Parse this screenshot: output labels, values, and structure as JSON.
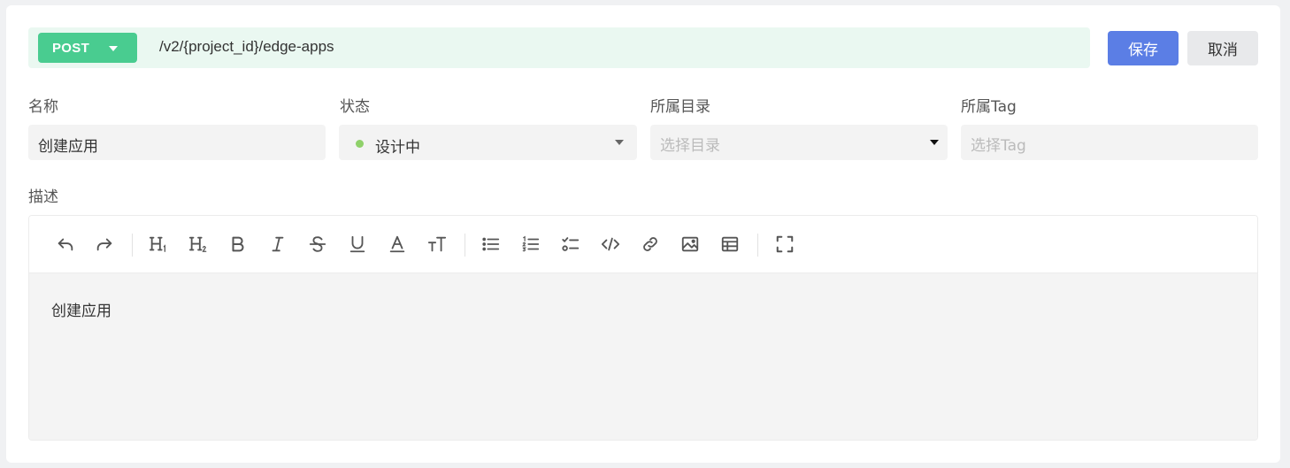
{
  "request": {
    "method": "POST",
    "path": "/v2/{project_id}/edge-apps"
  },
  "actions": {
    "save": "保存",
    "cancel": "取消"
  },
  "fields": {
    "name": {
      "label": "名称",
      "value": "创建应用"
    },
    "status": {
      "label": "状态",
      "value": "设计中",
      "dot_color": "#8fd16a"
    },
    "directory": {
      "label": "所属目录",
      "placeholder": "选择目录"
    },
    "tag": {
      "label": "所属Tag",
      "placeholder": "选择Tag"
    }
  },
  "description": {
    "label": "描述",
    "content": "创建应用",
    "toolbar": [
      "undo-icon",
      "redo-icon",
      "heading1-icon",
      "heading2-icon",
      "bold-icon",
      "italic-icon",
      "strikethrough-icon",
      "underline-icon",
      "font-color-icon",
      "font-size-icon",
      "bullet-list-icon",
      "ordered-list-icon",
      "task-list-icon",
      "code-icon",
      "link-icon",
      "image-icon",
      "table-icon",
      "fullscreen-icon"
    ]
  },
  "colors": {
    "method_bg": "#49cc90",
    "url_bar_bg": "#eaf8f1",
    "save_bg": "#5b7ee5"
  }
}
